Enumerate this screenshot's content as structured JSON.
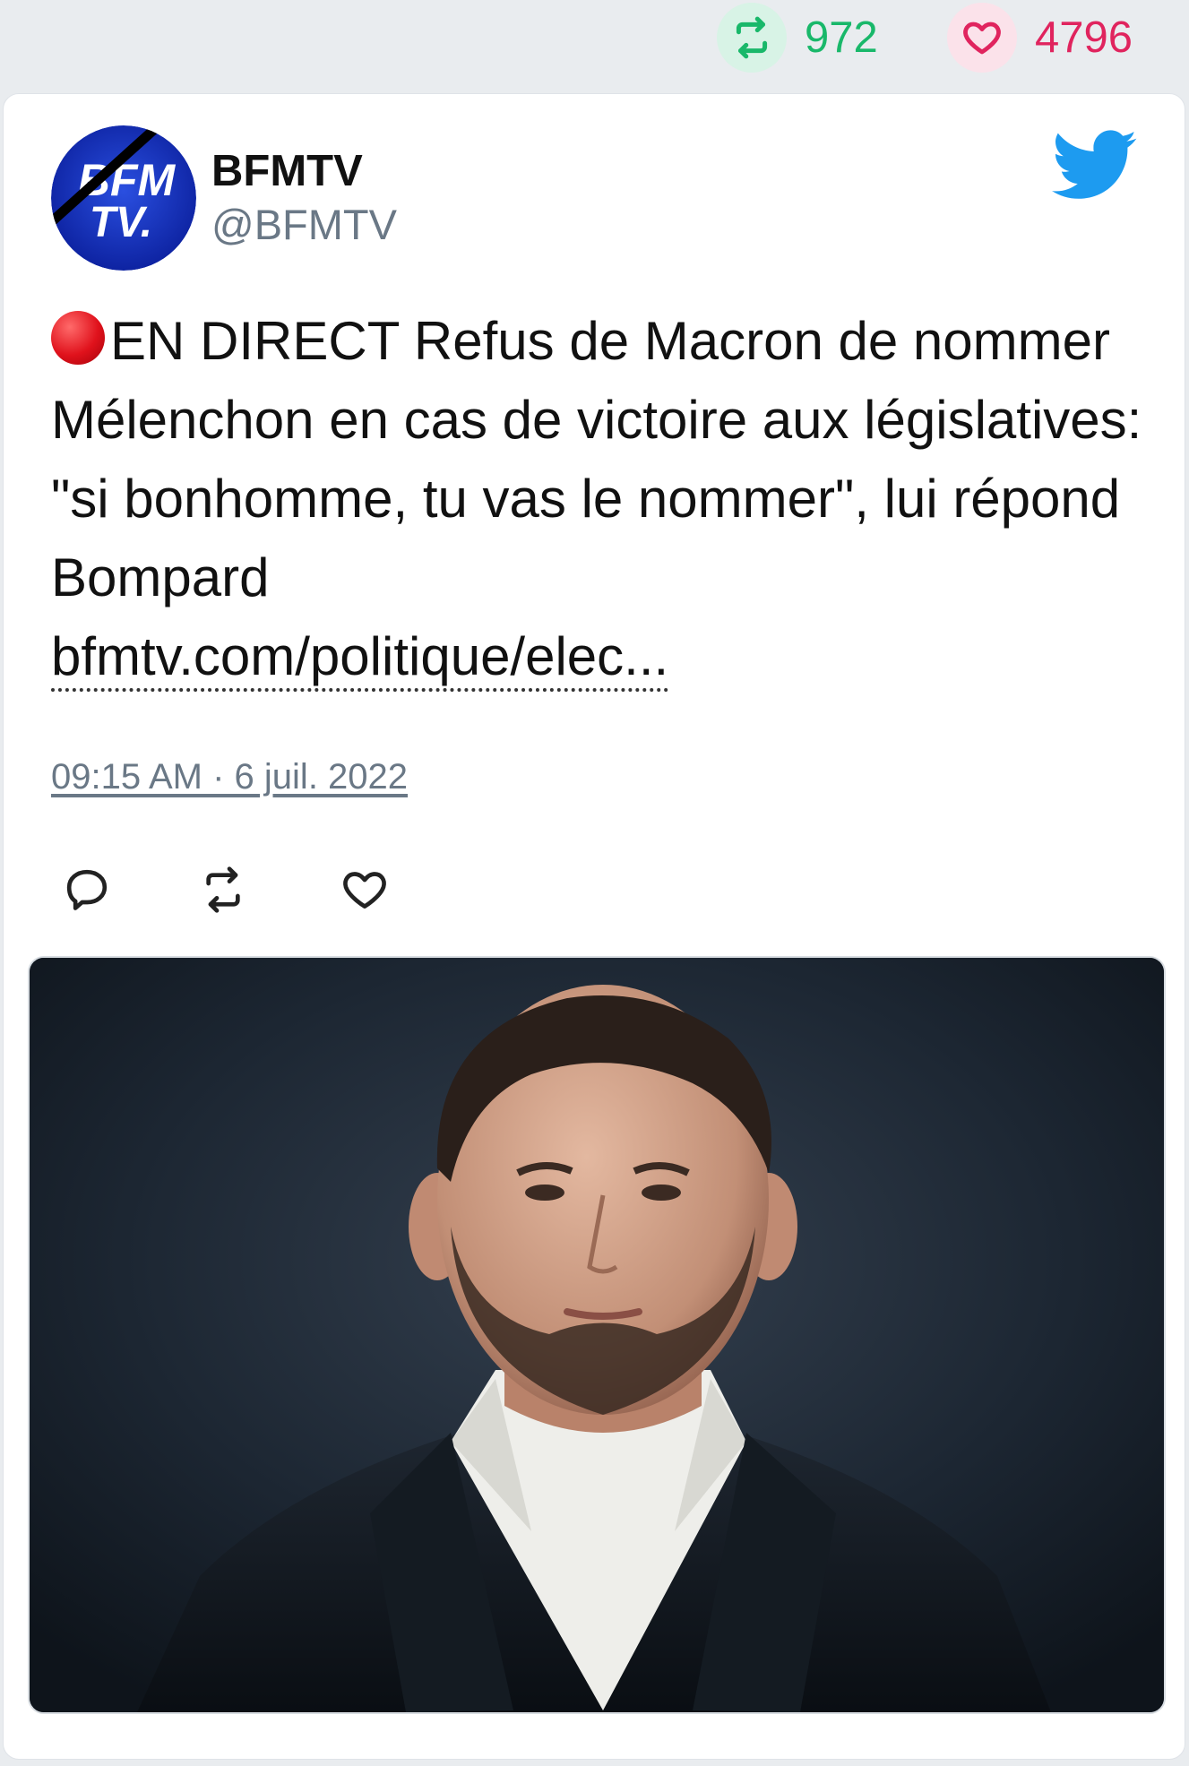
{
  "top_stats": {
    "retweets": "972",
    "likes": "4796"
  },
  "tweet": {
    "author_name": "BFMTV",
    "author_handle": "@BFMTV",
    "avatar_text_line1": "BFM",
    "avatar_text_line2": "TV.",
    "text": "EN DIRECT Refus de Macron de nommer Mélenchon en cas de victoire aux législatives: \"si bonhomme, tu vas le nommer\", lui répond Bompard",
    "link": "bfmtv.com/politique/elec...",
    "timestamp": "09:15 AM · 6 juil. 2022"
  },
  "colors": {
    "retweet_green": "#19b86a",
    "like_red": "#e0245e",
    "twitter_blue": "#1d9bf0"
  },
  "icons": {
    "retweet": "retweet-icon",
    "like": "heart-icon",
    "reply": "reply-icon",
    "brand": "twitter-bird-icon"
  }
}
